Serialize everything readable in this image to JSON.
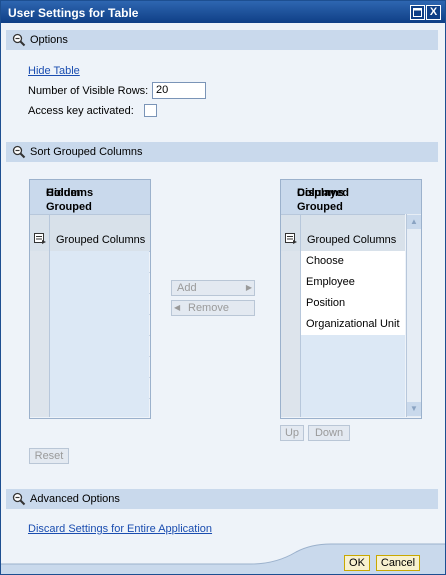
{
  "window": {
    "title": "User Settings for Table",
    "close_label": "X"
  },
  "options": {
    "header": "Options",
    "hide_table_link": "Hide Table",
    "visible_rows_label": "Number of Visible Rows:",
    "visible_rows_value": "20",
    "access_key_label": "Access key activated:",
    "access_key_checked": false
  },
  "sort_grouped": {
    "header": "Sort Grouped Columns",
    "hidden_panel": {
      "title_line1": "Hidden Grouped",
      "title_line2": "Columns",
      "column_header": "Grouped Columns"
    },
    "displayed_panel": {
      "title_line1": "Displayed Grouped",
      "title_line2": "Columns",
      "column_header": "Grouped Columns",
      "rows": [
        "Choose",
        "Employee",
        "Position",
        "Organizational Unit"
      ]
    },
    "add_label": "Add",
    "remove_label": "Remove",
    "up_label": "Up",
    "down_label": "Down",
    "reset_label": "Reset"
  },
  "advanced": {
    "header": "Advanced Options",
    "discard_link": "Discard Settings for Entire Application"
  },
  "footer": {
    "ok_label": "OK",
    "cancel_label": "Cancel"
  },
  "colors": {
    "title_bar": "#1a4c96",
    "section_header": "#c9d9ec",
    "body": "#eef3f9",
    "link": "#1a4db0"
  }
}
